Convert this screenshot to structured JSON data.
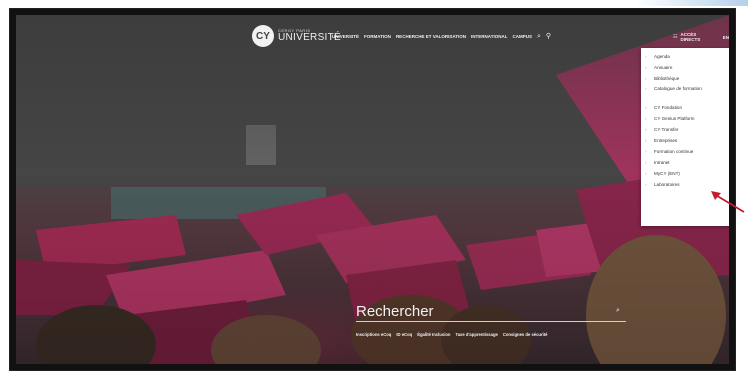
{
  "logo": {
    "mark": "CY",
    "small": "CERGY PARIS",
    "big": "UNIVERSITÉ"
  },
  "nav": {
    "items": [
      "UNIVERSITÉ",
      "FORMATION",
      "RECHERCHE ET VALORISATION",
      "INTERNATIONAL",
      "CAMPUS"
    ],
    "search_icon": "search-icon",
    "map_icon": "map-pin-icon"
  },
  "acces": {
    "label": "ACCÈS DIRECTS",
    "icon": "grid-icon",
    "lang": "EN"
  },
  "dropdown": {
    "items": [
      "Agenda",
      "Annuaire",
      "Bibliothèque",
      "Catalogue de formation",
      "CY Fondation",
      "CY Genius Platform",
      "CY Transfer",
      "Entreprises",
      "Formation continue",
      "Intranet",
      "MyCY (ENT)",
      "Laboratoires"
    ]
  },
  "search": {
    "title": "Rechercher",
    "links": [
      "Inscriptions eCoq",
      "ID eCoq",
      "Égalité Inclusion",
      "Taxe d'apprentissage",
      "Consignes de sécurité"
    ]
  },
  "colors": {
    "dropdown_bg": "#ffffff",
    "arrow": "#c41e2e",
    "overlay": "#3a3a3a"
  }
}
